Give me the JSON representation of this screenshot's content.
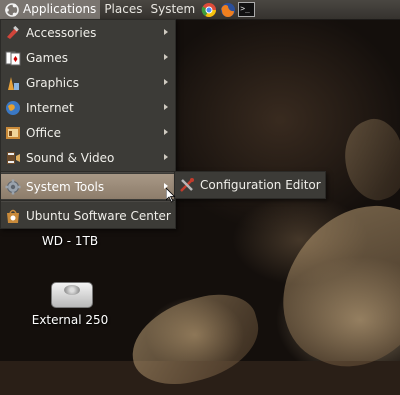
{
  "panel": {
    "applications": "Applications",
    "places": "Places",
    "system": "System",
    "launchers": [
      "chromium-icon",
      "firefox-icon",
      "terminal-icon"
    ]
  },
  "menu": {
    "items": [
      {
        "label": "Accessories",
        "icon": "accessories-icon"
      },
      {
        "label": "Games",
        "icon": "games-icon"
      },
      {
        "label": "Graphics",
        "icon": "graphics-icon"
      },
      {
        "label": "Internet",
        "icon": "internet-icon"
      },
      {
        "label": "Office",
        "icon": "office-icon"
      },
      {
        "label": "Sound & Video",
        "icon": "sound-video-icon"
      },
      {
        "label": "System Tools",
        "icon": "system-tools-icon"
      },
      {
        "label": "Ubuntu Software Center",
        "icon": "software-center-icon"
      }
    ]
  },
  "submenu": {
    "items": [
      {
        "label": "Configuration Editor",
        "icon": "configuration-editor-icon"
      }
    ]
  },
  "desktop": {
    "icons": [
      {
        "label": "WD - 1TB",
        "icon": "hard-drive-icon"
      },
      {
        "label": "External 250",
        "icon": "hard-drive-icon"
      }
    ]
  },
  "colors": {
    "panel": "#3f3c38",
    "menu_bg": "#3c3b37",
    "highlight": "#9a8a78"
  }
}
